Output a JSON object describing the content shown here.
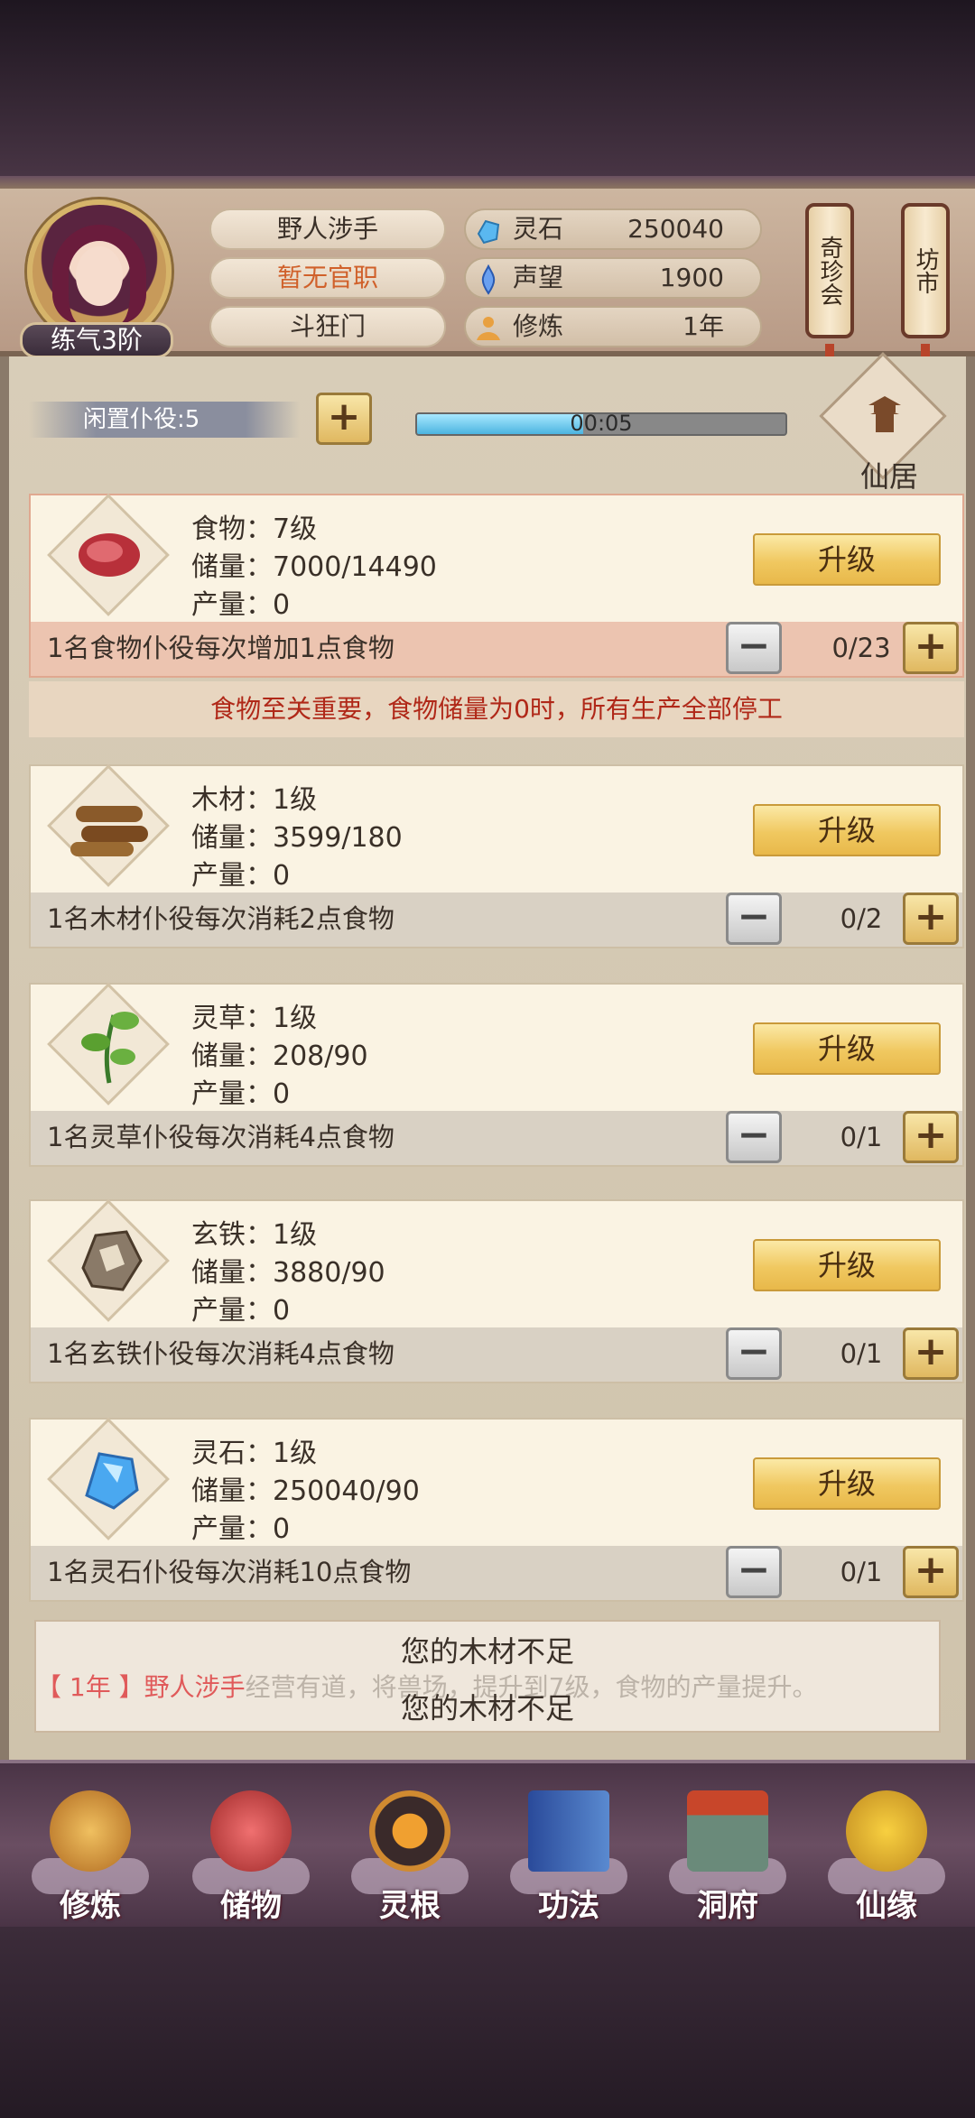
{
  "header": {
    "player_name": "野人涉手",
    "official_title": "暂无官职",
    "sect": "斗狂门",
    "rank": "练气3阶",
    "resources": [
      {
        "icon": "spirit-stone-icon",
        "name": "灵石",
        "value": "250040"
      },
      {
        "icon": "reputation-icon",
        "name": "声望",
        "value": "1900"
      },
      {
        "icon": "cultivation-icon",
        "name": "修炼",
        "value": "1年"
      }
    ],
    "side_tabs": [
      "奇珍会",
      "坊市"
    ]
  },
  "toolbar": {
    "idle_servants": "闲置仆役:5",
    "add_label": "+",
    "timer": "00:05",
    "timer_progress": 0.45,
    "residence_label": "仙居"
  },
  "cards": [
    {
      "name": "食物：7级",
      "storage": "储量：7000/14490",
      "output": "产量：0",
      "upgrade": "升级",
      "note": "1名食物仆役每次增加1点食物",
      "count": "0/23",
      "minus": "−",
      "plus": "+"
    },
    {
      "name": "木材：1级",
      "storage": "储量：3599/180",
      "output": "产量：0",
      "upgrade": "升级",
      "note": "1名木材仆役每次消耗2点食物",
      "count": "0/2",
      "minus": "−",
      "plus": "+"
    },
    {
      "name": "灵草：1级",
      "storage": "储量：208/90",
      "output": "产量：0",
      "upgrade": "升级",
      "note": "1名灵草仆役每次消耗4点食物",
      "count": "0/1",
      "minus": "−",
      "plus": "+"
    },
    {
      "name": "玄铁：1级",
      "storage": "储量：3880/90",
      "output": "产量：0",
      "upgrade": "升级",
      "note": "1名玄铁仆役每次消耗4点食物",
      "count": "0/1",
      "minus": "−",
      "plus": "+"
    },
    {
      "name": "灵石：1级",
      "storage": "储量：250040/90",
      "output": "产量：0",
      "upgrade": "升级",
      "note": "1名灵石仆役每次消耗10点食物",
      "count": "0/1",
      "minus": "−",
      "plus": "+"
    }
  ],
  "warning": "食物至关重要，食物储量为0时，所有生产全部停工",
  "toasts": [
    "您的木材不足",
    "您的木材不足"
  ],
  "ticker": {
    "year": "【 1年 】",
    "name": "野人涉手",
    "text": "经营有道，将兽场，提升到7级，食物的产量提升。"
  },
  "nav": [
    "修炼",
    "储物",
    "灵根",
    "功法",
    "洞府",
    "仙缘"
  ],
  "colors": {
    "accent_gold": "#f0c860",
    "warning_red": "#b02818",
    "timer_blue": "#4cb4e0"
  }
}
